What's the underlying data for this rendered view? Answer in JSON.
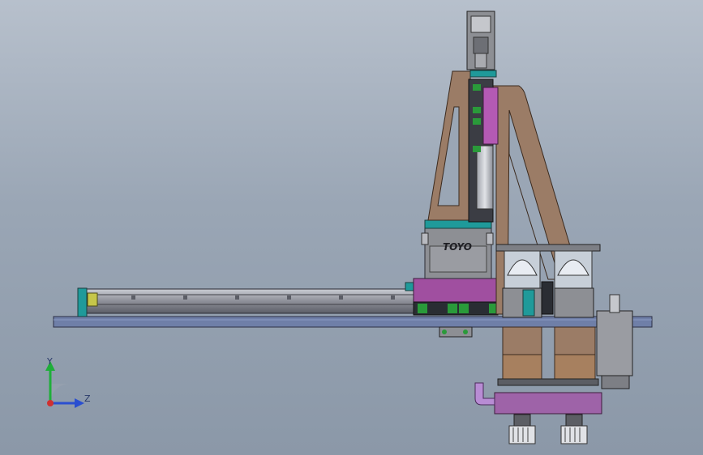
{
  "brand_label": "TOYO",
  "triad": {
    "y_label": "Y",
    "z_label": "Z"
  },
  "colors": {
    "base_plate": "#6f7fa8",
    "frame_brown": "#9b7c66",
    "carriage_purple": "#a04fa0",
    "cyan_accent": "#1f9a9a",
    "green_accent": "#2a9a3a",
    "rail_gray": "#7e7e86",
    "motor_gray": "#8d8f94",
    "axis_y": "#1fae3a",
    "axis_z": "#2a4fd0",
    "axis_origin": "#d03030"
  }
}
